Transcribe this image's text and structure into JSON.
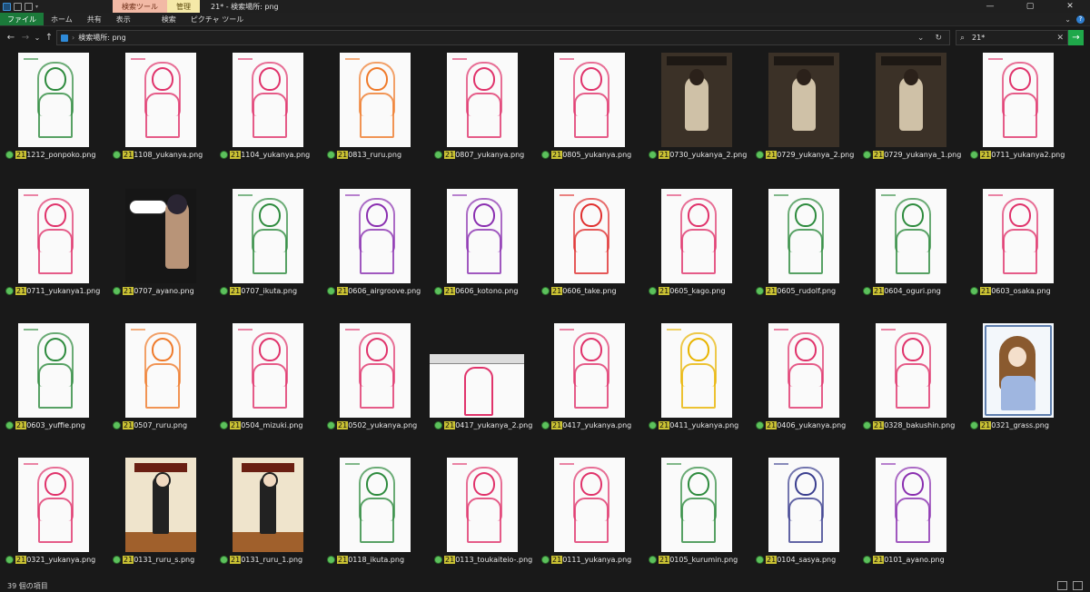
{
  "titlebar": {
    "context_search_tab": "検索ツール",
    "context_manage_tab": "管理",
    "window_title": "21* - 検索場所: png",
    "minimize": "—",
    "maximize": "▢",
    "close": "✕"
  },
  "ribbon": {
    "tabs": [
      "ファイル",
      "ホーム",
      "共有",
      "表示",
      "検索",
      "ピクチャ ツール"
    ],
    "expand_glyph": "⌄",
    "help_glyph": "?"
  },
  "nav": {
    "back": "←",
    "forward": "→",
    "recent": "⌄",
    "up": "↑",
    "address_separator": "›",
    "address_text": "検索場所: png",
    "address_dropdown": "⌄",
    "refresh": "↻",
    "search_glyph": "⌕",
    "search_value": "21*",
    "search_clear": "✕",
    "go": "→"
  },
  "files": [
    {
      "name": "211212_ponpoko.png",
      "kind": "sketch",
      "color": "#2e8b3e"
    },
    {
      "name": "211108_yukanya.png",
      "kind": "sketch",
      "color": "#e0336b"
    },
    {
      "name": "211104_yukanya.png",
      "kind": "sketch",
      "color": "#e0336b"
    },
    {
      "name": "210813_ruru.png",
      "kind": "sketch",
      "color": "#ef7a2a"
    },
    {
      "name": "210807_yukanya.png",
      "kind": "sketch",
      "color": "#e0336b"
    },
    {
      "name": "210805_yukanya.png",
      "kind": "sketch",
      "color": "#e0336b"
    },
    {
      "name": "210730_yukanya_2.png",
      "kind": "photo",
      "color": "#3b3127"
    },
    {
      "name": "210729_yukanya_2.png",
      "kind": "photo",
      "color": "#3b3127"
    },
    {
      "name": "210729_yukanya_1.png",
      "kind": "photo",
      "color": "#3b3127"
    },
    {
      "name": "210711_yukanya2.png",
      "kind": "sketch",
      "color": "#e0336b"
    },
    {
      "name": "210711_yukanya1.png",
      "kind": "sketch",
      "color": "#e0336b"
    },
    {
      "name": "210707_ayano.png",
      "kind": "dark",
      "color": "#161616"
    },
    {
      "name": "210707_ikuta.png",
      "kind": "sketch",
      "color": "#2e8b3e"
    },
    {
      "name": "210606_airgroove.png",
      "kind": "sketch",
      "color": "#8a2fb0"
    },
    {
      "name": "210606_kotono.png",
      "kind": "sketch",
      "color": "#8a2fb0"
    },
    {
      "name": "210606_take.png",
      "kind": "sketch",
      "color": "#e0302f"
    },
    {
      "name": "210605_kago.png",
      "kind": "sketch",
      "color": "#e0336b"
    },
    {
      "name": "210605_rudolf.png",
      "kind": "sketch",
      "color": "#2e8b3e"
    },
    {
      "name": "210604_oguri.png",
      "kind": "sketch",
      "color": "#2e8b3e"
    },
    {
      "name": "210603_osaka.png",
      "kind": "sketch",
      "color": "#e0336b"
    },
    {
      "name": "210603_yuffie.png",
      "kind": "sketch",
      "color": "#2e8b3e"
    },
    {
      "name": "210507_ruru.png",
      "kind": "sketch",
      "color": "#ef7a2a"
    },
    {
      "name": "210504_mizuki.png",
      "kind": "sketch",
      "color": "#e0336b"
    },
    {
      "name": "210502_yukanya.png",
      "kind": "sketch",
      "color": "#e0336b"
    },
    {
      "name": "210417_yukanya_2.png",
      "kind": "wide",
      "color": "#e0336b"
    },
    {
      "name": "210417_yukanya.png",
      "kind": "sketch",
      "color": "#e0336b"
    },
    {
      "name": "210411_yukanya.png",
      "kind": "sketch",
      "color": "#e8b400"
    },
    {
      "name": "210406_yukanya.png",
      "kind": "sketch",
      "color": "#e0336b"
    },
    {
      "name": "210328_bakushin.png",
      "kind": "sketch",
      "color": "#e0336b"
    },
    {
      "name": "210321_grass.png",
      "kind": "card",
      "color": "#5f7fae"
    },
    {
      "name": "210321_yukanya.png",
      "kind": "sketch",
      "color": "#e0336b"
    },
    {
      "name": "210131_ruru_s.png",
      "kind": "cafe",
      "color": "#a0602c"
    },
    {
      "name": "210131_ruru_1.png",
      "kind": "cafe",
      "color": "#a0602c"
    },
    {
      "name": "210118_ikuta.png",
      "kind": "sketch",
      "color": "#2e8b3e"
    },
    {
      "name": "210113_toukaiteio-.png",
      "kind": "sketch",
      "color": "#e0336b"
    },
    {
      "name": "210111_yukanya.png",
      "kind": "sketch",
      "color": "#e0336b"
    },
    {
      "name": "210105_kurumin.png",
      "kind": "sketch",
      "color": "#2e8b3e"
    },
    {
      "name": "210104_sasya.png",
      "kind": "sketch",
      "color": "#3b3f8f"
    },
    {
      "name": "210101_ayano.png",
      "kind": "sketch",
      "color": "#8a2fb0"
    }
  ],
  "statusbar": {
    "item_count": "39 個の項目"
  },
  "colors": {
    "background": "#191919",
    "file_tab": "#1b7a3a",
    "search_highlight": "#c9c133",
    "go_button": "#1fa84a",
    "status_ok": "#5cc15c"
  }
}
